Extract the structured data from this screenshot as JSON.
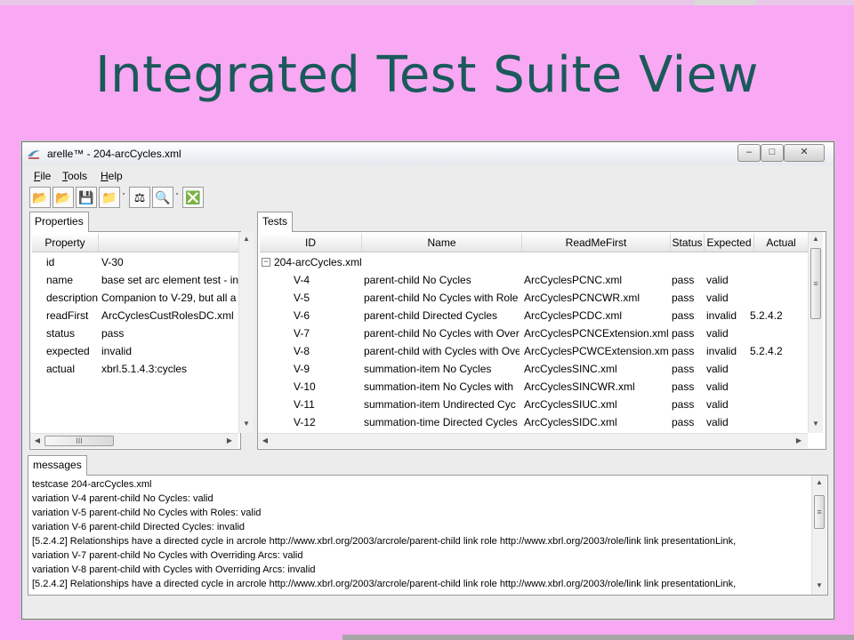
{
  "slide": {
    "title": "Integrated Test Suite View"
  },
  "window": {
    "title": "arelle™ - 204-arcCycles.xml",
    "controls": {
      "minimize": "–",
      "maximize": "□",
      "close": "✕"
    }
  },
  "menu": [
    "File",
    "Tools",
    "Help"
  ],
  "toolbar": [
    {
      "name": "open-folder-icon",
      "glyph": "📂"
    },
    {
      "name": "open-web-icon",
      "glyph": "📂"
    },
    {
      "name": "save-icon",
      "glyph": "💾"
    },
    {
      "name": "close-file-icon",
      "glyph": "📁"
    },
    {
      "name": "validate-icon",
      "glyph": "⚖"
    },
    {
      "name": "compare-icon",
      "glyph": "🔍"
    },
    {
      "name": "clear-log-icon",
      "glyph": "❎"
    }
  ],
  "properties": {
    "tab": "Properties",
    "columns": [
      "Property",
      ""
    ],
    "rows": [
      {
        "property": "id",
        "value": "V-30"
      },
      {
        "property": "name",
        "value": "base set arc element test - inv"
      },
      {
        "property": "description",
        "value": "Companion to V-29, but all a"
      },
      {
        "property": "readFirst",
        "value": "ArcCyclesCustRolesDC.xml"
      },
      {
        "property": "status",
        "value": "pass"
      },
      {
        "property": "expected",
        "value": "invalid"
      },
      {
        "property": "actual",
        "value": "xbrl.5.1.4.3:cycles"
      }
    ]
  },
  "tests": {
    "tab": "Tests",
    "columns": [
      "ID",
      "Name",
      "ReadMeFirst",
      "Status",
      "Expected",
      "Actual"
    ],
    "group": {
      "expander": "−",
      "label": "204-arcCycles.xml"
    },
    "rows": [
      {
        "id": "V-4",
        "name": "parent-child No Cycles",
        "readme": "ArcCyclesPCNC.xml",
        "status": "pass",
        "expected": "valid",
        "actual": ""
      },
      {
        "id": "V-5",
        "name": "parent-child No Cycles with Role",
        "readme": "ArcCyclesPCNCWR.xml",
        "status": "pass",
        "expected": "valid",
        "actual": ""
      },
      {
        "id": "V-6",
        "name": "parent-child Directed Cycles",
        "readme": "ArcCyclesPCDC.xml",
        "status": "pass",
        "expected": "invalid",
        "actual": "5.2.4.2"
      },
      {
        "id": "V-7",
        "name": "parent-child No Cycles with Over",
        "readme": "ArcCyclesPCNCExtension.xml",
        "status": "pass",
        "expected": "valid",
        "actual": ""
      },
      {
        "id": "V-8",
        "name": "parent-child with Cycles with Ove",
        "readme": "ArcCyclesPCWCExtension.xml",
        "status": "pass",
        "expected": "invalid",
        "actual": "5.2.4.2"
      },
      {
        "id": "V-9",
        "name": "summation-item No Cycles",
        "readme": "ArcCyclesSINC.xml",
        "status": "pass",
        "expected": "valid",
        "actual": ""
      },
      {
        "id": "V-10",
        "name": "summation-item No Cycles with",
        "readme": "ArcCyclesSINCWR.xml",
        "status": "pass",
        "expected": "valid",
        "actual": ""
      },
      {
        "id": "V-11",
        "name": "summation-item Undirected Cyc",
        "readme": "ArcCyclesSIUC.xml",
        "status": "pass",
        "expected": "valid",
        "actual": ""
      },
      {
        "id": "V-12",
        "name": "summation-time Directed Cycles",
        "readme": "ArcCyclesSIDC.xml",
        "status": "pass",
        "expected": "valid",
        "actual": ""
      }
    ]
  },
  "messages": {
    "tab": "messages",
    "lines": [
      "testcase 204-arcCycles.xml",
      "variation V-4 parent-child No Cycles: valid",
      "variation V-5 parent-child No Cycles with Roles: valid",
      "variation V-6 parent-child Directed Cycles: invalid",
      "[5.2.4.2] Relationships have a directed cycle in arcrole http://www.xbrl.org/2003/arcrole/parent-child link role http://www.xbrl.org/2003/role/link link presentationLink,",
      "variation V-7 parent-child No Cycles with Overriding Arcs: valid",
      "variation V-8 parent-child with Cycles with Overriding Arcs: invalid",
      "[5.2.4.2] Relationships have a directed cycle in arcrole http://www.xbrl.org/2003/arcrole/parent-child link role http://www.xbrl.org/2003/role/link link presentationLink,"
    ]
  },
  "scroll": {
    "up": "▲",
    "down": "▼",
    "left": "◀",
    "right": "▶",
    "grip_h": "III",
    "grip_v": "≡"
  },
  "colors": {
    "slide_bg": "#f9a8f4",
    "title_color": "#1a5a5a"
  }
}
